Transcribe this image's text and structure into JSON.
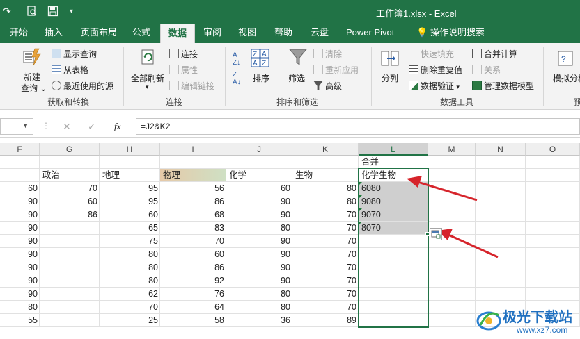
{
  "title_bar": {
    "title": "工作簿1.xlsx  -  Excel",
    "qa_undo": "↶",
    "qa_redo": "↷",
    "qa_preview": "🔍",
    "qa_save": "💾",
    "qa_more": "▾"
  },
  "tabs": [
    "开始",
    "插入",
    "页面布局",
    "公式",
    "数据",
    "审阅",
    "视图",
    "帮助",
    "云盘",
    "Power Pivot",
    "操作说明搜索"
  ],
  "active_tab": "数据",
  "ribbon": {
    "get_transform": {
      "new_query": "新建",
      "new_query2": "查询",
      "show_query": "显示查询",
      "from_table": "从表格",
      "recent_sources": "最近使用的源",
      "label": "获取和转换"
    },
    "connections": {
      "refresh_all": "全部刷新",
      "connections": "连接",
      "properties": "属性",
      "edit_links": "编辑链接",
      "label": "连接"
    },
    "sort_filter": {
      "sort": "排序",
      "filter": "筛选",
      "clear": "清除",
      "reapply": "重新应用",
      "advanced": "高级",
      "label": "排序和筛选"
    },
    "data_tools": {
      "split": "分列",
      "flash_fill": "快速填充",
      "remove_dup": "删除重复值",
      "validation": "数据验证",
      "consolidate": "合并计算",
      "relations": "关系",
      "data_model": "管理数据模型",
      "label": "数据工具"
    },
    "forecast": {
      "whatif": "模拟分析",
      "label": "预"
    }
  },
  "formula_bar": {
    "cancel": "✕",
    "enter": "✓",
    "fx": "fx",
    "formula": "=J2&K2"
  },
  "columns": [
    "F",
    "G",
    "H",
    "I",
    "J",
    "K",
    "L",
    "M",
    "N",
    "O"
  ],
  "merge_title": "合并",
  "header_row": [
    "",
    "政治",
    "地理",
    "物理",
    "化学",
    "生物",
    "化学生物"
  ],
  "rows": [
    [
      "60",
      "70",
      "95",
      "56",
      "60",
      "80",
      "6080"
    ],
    [
      "90",
      "60",
      "95",
      "86",
      "90",
      "80",
      "9080"
    ],
    [
      "90",
      "86",
      "60",
      "68",
      "90",
      "70",
      "9070"
    ],
    [
      "90",
      "",
      "65",
      "83",
      "80",
      "70",
      "8070"
    ],
    [
      "90",
      "",
      "75",
      "70",
      "90",
      "70",
      ""
    ],
    [
      "90",
      "",
      "80",
      "60",
      "90",
      "70",
      ""
    ],
    [
      "90",
      "",
      "80",
      "86",
      "90",
      "70",
      ""
    ],
    [
      "90",
      "",
      "80",
      "92",
      "90",
      "70",
      ""
    ],
    [
      "90",
      "",
      "62",
      "76",
      "80",
      "70",
      ""
    ],
    [
      "80",
      "",
      "70",
      "64",
      "80",
      "70",
      ""
    ],
    [
      "55",
      "",
      "25",
      "58",
      "36",
      "89",
      ""
    ]
  ],
  "watermark": {
    "cn": "极光下载站",
    "url": "www.xz7.com"
  },
  "colors": {
    "excel_green": "#217346",
    "arrow_red": "#d6242b"
  }
}
